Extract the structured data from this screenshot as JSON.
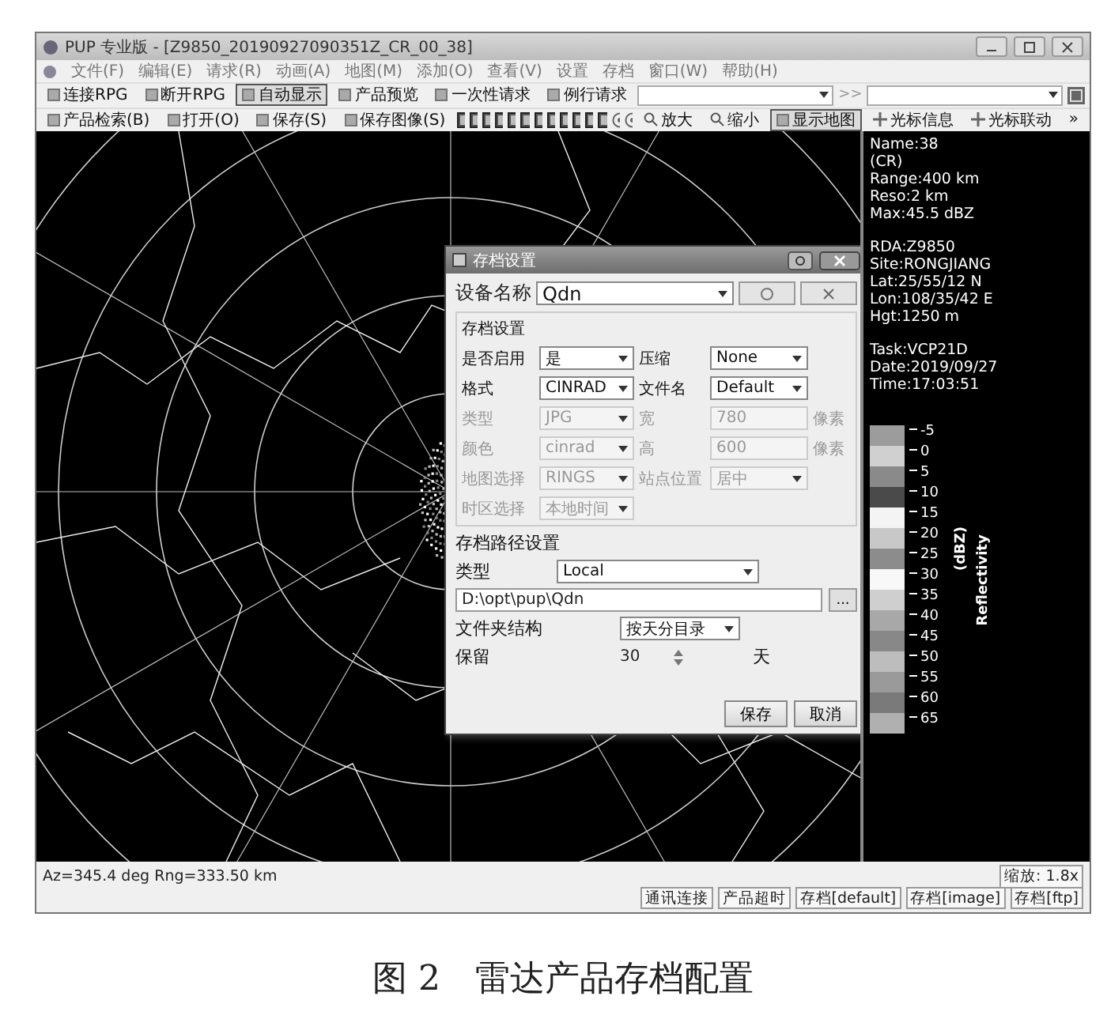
{
  "window": {
    "title": "PUP 专业版 - [Z9850_20190927090351Z_CR_00_38]"
  },
  "menu": [
    "文件(F)",
    "编辑(E)",
    "请求(R)",
    "动画(A)",
    "地图(M)",
    "添加(O)",
    "查看(V)",
    "设置",
    "存档",
    "窗口(W)",
    "帮助(H)"
  ],
  "toolbar_top": {
    "buttons": [
      {
        "label": "连接RPG",
        "pressed": false
      },
      {
        "label": "断开RPG",
        "pressed": false
      },
      {
        "label": "自动显示",
        "pressed": true
      },
      {
        "label": "产品预览",
        "pressed": false
      },
      {
        "label": "一次性请求",
        "pressed": false
      },
      {
        "label": "例行请求",
        "pressed": false
      }
    ],
    "separator": ">>"
  },
  "toolbar_bottom": [
    {
      "kind": "button",
      "label": "产品检索(B)",
      "pressed": false
    },
    {
      "kind": "button",
      "label": "打开(O)",
      "pressed": false
    },
    {
      "kind": "button",
      "label": "保存(S)",
      "pressed": false
    },
    {
      "kind": "button",
      "label": "保存图像(S)",
      "pressed": false
    },
    {
      "kind": "square"
    },
    {
      "kind": "square"
    },
    {
      "kind": "square"
    },
    {
      "kind": "square"
    },
    {
      "kind": "square"
    },
    {
      "kind": "square"
    },
    {
      "kind": "square"
    },
    {
      "kind": "square"
    },
    {
      "kind": "square"
    },
    {
      "kind": "square"
    },
    {
      "kind": "square"
    },
    {
      "kind": "square"
    },
    {
      "kind": "circle"
    },
    {
      "kind": "circle"
    },
    {
      "kind": "zoom",
      "label": "放大",
      "pressed": false
    },
    {
      "kind": "zoom",
      "label": "缩小",
      "pressed": false
    },
    {
      "kind": "button",
      "label": "显示地图",
      "pressed": true
    },
    {
      "kind": "cursor",
      "label": "光标信息",
      "pressed": false
    },
    {
      "kind": "cursor",
      "label": "光标联动",
      "pressed": false
    },
    {
      "kind": "more",
      "label": "»"
    }
  ],
  "info_groups": [
    [
      "Name:38",
      "(CR)",
      "Range:400 km",
      "Reso:2 km",
      "Max:45.5 dBZ"
    ],
    [
      "RDA:Z9850",
      "Site:RONGJIANG",
      "Lat:25/55/12 N",
      "Lon:108/35/42 E",
      "Hgt:1250 m"
    ],
    [
      "Task:VCP21D",
      "Date:2019/09/27",
      "Time:17:03:51"
    ]
  ],
  "colorbar": {
    "title": "Reflectivity",
    "unit": "(dBZ)",
    "levels": [
      {
        "label": "-5",
        "color": "#9c9c9c"
      },
      {
        "label": "0",
        "color": "#d0d0d0"
      },
      {
        "label": "5",
        "color": "#8a8a8a"
      },
      {
        "label": "10",
        "color": "#4a4a4a"
      },
      {
        "label": "15",
        "color": "#f4f4f4"
      },
      {
        "label": "20",
        "color": "#c8c8c8"
      },
      {
        "label": "25",
        "color": "#8c8c8c"
      },
      {
        "label": "30",
        "color": "#f8f8f8"
      },
      {
        "label": "35",
        "color": "#cfcfcf"
      },
      {
        "label": "40",
        "color": "#a8a8a8"
      },
      {
        "label": "45",
        "color": "#888888"
      },
      {
        "label": "50",
        "color": "#bdbdbd"
      },
      {
        "label": "55",
        "color": "#9a9a9a"
      },
      {
        "label": "60",
        "color": "#7a7a7a"
      },
      {
        "label": "65",
        "color": "#b0b0b0"
      }
    ]
  },
  "dialog": {
    "title": "存档设置",
    "device_label": "设备名称",
    "device": "Qdn",
    "group_title": "存档设置",
    "rows": [
      {
        "disabled": false,
        "cells": [
          {
            "label": "是否启用",
            "value": "是",
            "kind": "select"
          },
          {
            "label": "压缩",
            "value": "None",
            "kind": "select"
          }
        ]
      },
      {
        "disabled": false,
        "cells": [
          {
            "label": "格式",
            "value": "CINRAD",
            "kind": "select"
          },
          {
            "label": "文件名",
            "value": "Default",
            "kind": "select"
          }
        ]
      },
      {
        "disabled": true,
        "cells": [
          {
            "label": "类型",
            "value": "JPG",
            "kind": "select"
          },
          {
            "label": "宽",
            "value": "780",
            "kind": "text",
            "unit": "像素"
          }
        ]
      },
      {
        "disabled": true,
        "cells": [
          {
            "label": "颜色",
            "value": "cinrad",
            "kind": "select"
          },
          {
            "label": "高",
            "value": "600",
            "kind": "text",
            "unit": "像素"
          }
        ]
      },
      {
        "disabled": true,
        "cells": [
          {
            "label": "地图选择",
            "value": "RINGS",
            "kind": "select"
          },
          {
            "label": "站点位置",
            "value": "居中",
            "kind": "select"
          }
        ]
      },
      {
        "disabled": true,
        "cells": [
          {
            "label": "时区选择",
            "value": "本地时间",
            "kind": "select"
          }
        ]
      }
    ],
    "path": {
      "title": "存档路径设置",
      "type_label": "类型",
      "type": "Local",
      "folder": "D:\\opt\\pup\\Qdn",
      "browse": "...",
      "structure_label": "文件夹结构",
      "structure": "按天分目录",
      "keep_label": "保留",
      "keep": "30",
      "keep_unit": "天"
    },
    "buttons": [
      "保存",
      "取消"
    ]
  },
  "status": {
    "readout": "Az=345.4 deg Rng=333.50 km",
    "zoom": "缩放: 1.8x",
    "indicators": [
      "通讯连接",
      "产品超时",
      "存档[default]",
      "存档[image]",
      "存档[ftp]"
    ]
  },
  "caption": {
    "figure": "图 2",
    "title": "雷达产品存档配置"
  }
}
